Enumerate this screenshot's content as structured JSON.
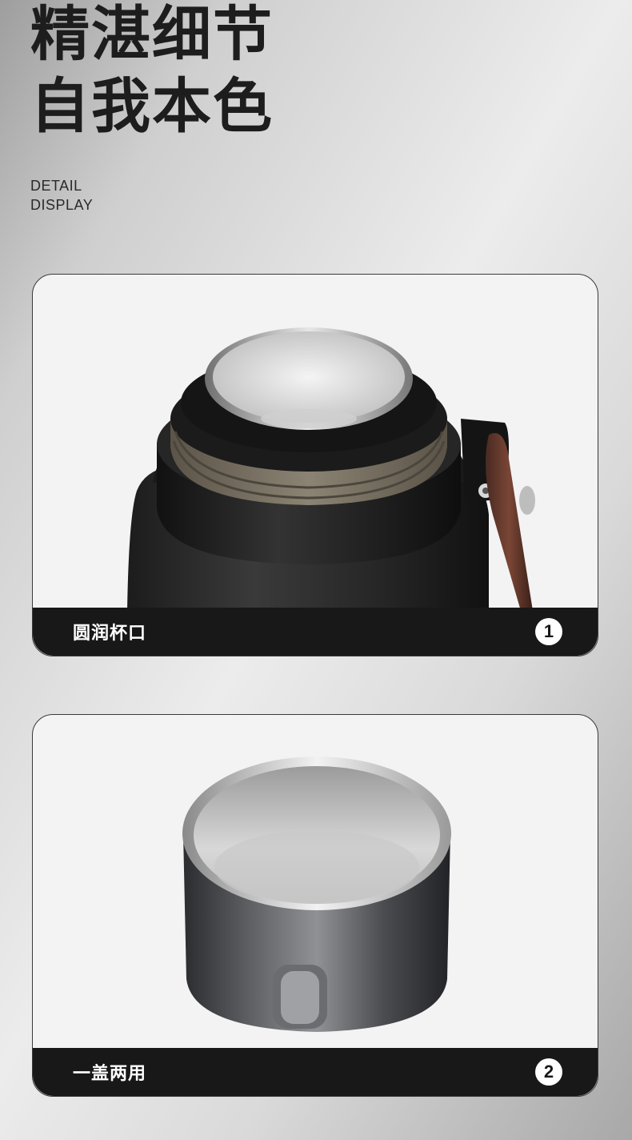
{
  "headline": {
    "line1": "精湛细节",
    "line2": "自我本色"
  },
  "subtitle": {
    "line1": "DETAIL",
    "line2": "DISPLAY"
  },
  "cards": [
    {
      "caption": "圆润杯口",
      "number": "1",
      "image": "bottle-mouth-closeup"
    },
    {
      "caption": "一盖两用",
      "number": "2",
      "image": "stainless-cup-lid"
    }
  ]
}
